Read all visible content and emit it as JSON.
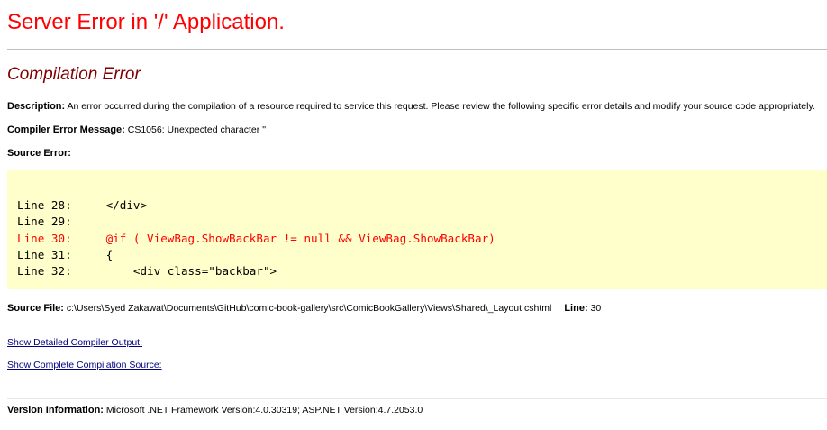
{
  "page": {
    "title": "Server Error in '/' Application.",
    "error_heading": "Compilation Error"
  },
  "description": {
    "label": "Description:",
    "text": "An error occurred during the compilation of a resource required to service this request. Please review the following specific error details and modify your source code appropriately."
  },
  "compiler_error": {
    "label": "Compiler Error Message:",
    "text": "CS1056: Unexpected character ''"
  },
  "source_error": {
    "label": "Source Error:",
    "lines": [
      {
        "text": "Line 28:     </div>",
        "highlight": false
      },
      {
        "text": "Line 29:",
        "highlight": false
      },
      {
        "text": "Line 30:     @if ( ViewBag.ShowBackBar != null && ViewBag.ShowBackBar)",
        "highlight": true
      },
      {
        "text": "Line 31:     {",
        "highlight": false
      },
      {
        "text": "Line 32:         <div class=\"backbar\">",
        "highlight": false
      }
    ]
  },
  "source_file": {
    "label": "Source File:",
    "path": "c:\\Users\\Syed Zakawat\\Documents\\GitHub\\comic-book-gallery\\src\\ComicBookGallery\\Views\\Shared\\_Layout.cshtml",
    "line_label": "Line:",
    "line_value": "30"
  },
  "links": {
    "compiler_output": "Show Detailed Compiler Output:",
    "compilation_source": "Show Complete Compilation Source:"
  },
  "version": {
    "label": "Version Information:",
    "text": "Microsoft .NET Framework Version:4.0.30319; ASP.NET Version:4.7.2053.0"
  },
  "colors": {
    "title": "#ff0000",
    "heading": "#800000",
    "code_background": "#ffffcc",
    "highlight_line": "#ff0000",
    "link": "#000080"
  }
}
